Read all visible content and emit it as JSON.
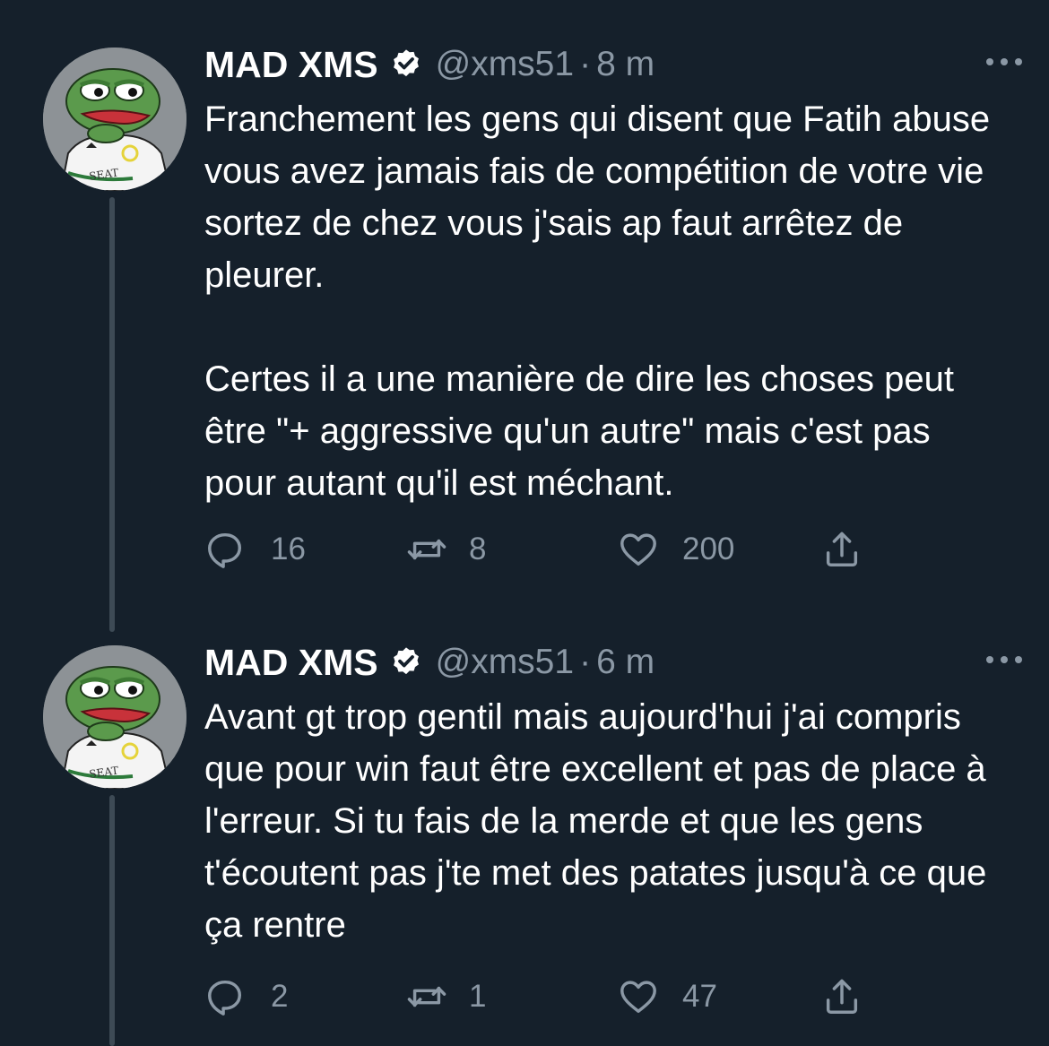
{
  "tweets": [
    {
      "author": {
        "display_name": "MAD XMS",
        "handle": "@xms51",
        "verified": true,
        "avatar": "pepe-frog-avatar"
      },
      "separator": "·",
      "time": "8 m",
      "paragraphs": [
        "Franchement les gens qui disent que Fatih abuse vous avez jamais fais de compétition de votre vie sortez de chez vous j'sais ap faut arrêtez de pleurer.",
        "Certes il a une manière de dire les choses peut être \"+ aggressive qu'un autre\" mais c'est pas pour autant qu'il est méchant."
      ],
      "stats": {
        "replies": "16",
        "retweets": "8",
        "likes": "200"
      }
    },
    {
      "author": {
        "display_name": "MAD XMS",
        "handle": "@xms51",
        "verified": true,
        "avatar": "pepe-frog-avatar"
      },
      "separator": "·",
      "time": "6 m",
      "paragraphs": [
        "Avant gt trop gentil mais aujourd'hui j'ai compris que pour win faut être excellent et pas de place à l'erreur. Si tu fais de la merde et que les gens t'écoutent pas j'te met des patates jusqu'à ce que ça rentre"
      ],
      "stats": {
        "replies": "2",
        "retweets": "1",
        "likes": "47"
      }
    }
  ],
  "avatar_jersey_text": "SEAT",
  "icons": {
    "verified": "verified-badge-icon",
    "more": "more-options-icon",
    "reply": "reply-icon",
    "retweet": "retweet-icon",
    "like": "heart-icon",
    "share": "share-icon"
  },
  "colors": {
    "background": "#15202b",
    "text_primary": "#ffffff",
    "text_secondary": "#8b98a5",
    "thread_line": "#3d4a55"
  }
}
